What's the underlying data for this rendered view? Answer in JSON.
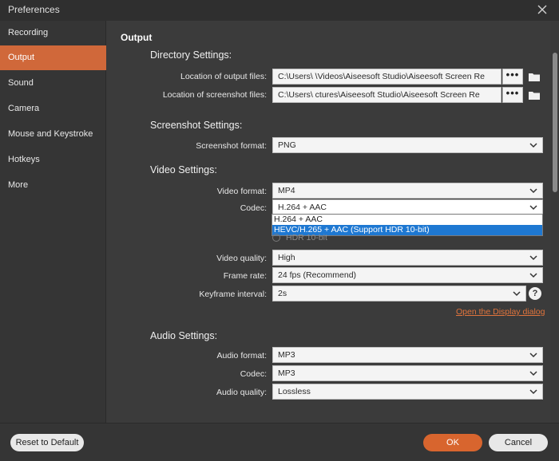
{
  "window": {
    "title": "Preferences"
  },
  "sidebar": {
    "items": [
      {
        "label": "Recording",
        "active": false
      },
      {
        "label": "Output",
        "active": true
      },
      {
        "label": "Sound",
        "active": false
      },
      {
        "label": "Camera",
        "active": false
      },
      {
        "label": "Mouse and Keystroke",
        "active": false
      },
      {
        "label": "Hotkeys",
        "active": false
      },
      {
        "label": "More",
        "active": false
      }
    ]
  },
  "output": {
    "heading": "Output",
    "directory": {
      "heading": "Directory Settings:",
      "output_files_label": "Location of output files:",
      "output_files_value": "C:\\Users\\        \\Videos\\Aiseesoft Studio\\Aiseesoft Screen Re",
      "screenshot_files_label": "Location of screenshot files:",
      "screenshot_files_value": "C:\\Users\\            ctures\\Aiseesoft Studio\\Aiseesoft Screen Re",
      "browse_label": "•••"
    },
    "screenshot": {
      "heading": "Screenshot Settings:",
      "format_label": "Screenshot format:",
      "format_value": "PNG"
    },
    "video": {
      "heading": "Video Settings:",
      "format_label": "Video format:",
      "format_value": "MP4",
      "codec_label": "Codec:",
      "codec_value": "H.264 + AAC",
      "codec_options": [
        "H.264 + AAC",
        "HEVC/H.265 + AAC (Support HDR 10-bit)"
      ],
      "codec_highlighted": "HEVC/H.265 + AAC (Support HDR 10-bit)",
      "hdr_label": "HDR 10-bit",
      "quality_label": "Video quality:",
      "quality_value": "High",
      "framerate_label": "Frame rate:",
      "framerate_value": "24 fps (Recommend)",
      "keyframe_label": "Keyframe interval:",
      "keyframe_value": "2s",
      "help_label": "?",
      "display_link": "Open the Display dialog"
    },
    "audio": {
      "heading": "Audio Settings:",
      "format_label": "Audio format:",
      "format_value": "MP3",
      "codec_label": "Codec:",
      "codec_value": "MP3",
      "quality_label": "Audio quality:",
      "quality_value": "Lossless"
    }
  },
  "footer": {
    "reset_label": "Reset to Default",
    "ok_label": "OK",
    "cancel_label": "Cancel"
  },
  "colors": {
    "accent": "#d0683a",
    "background": "#3b3b3b",
    "selection": "#1e78d2",
    "link": "#e0743c"
  }
}
